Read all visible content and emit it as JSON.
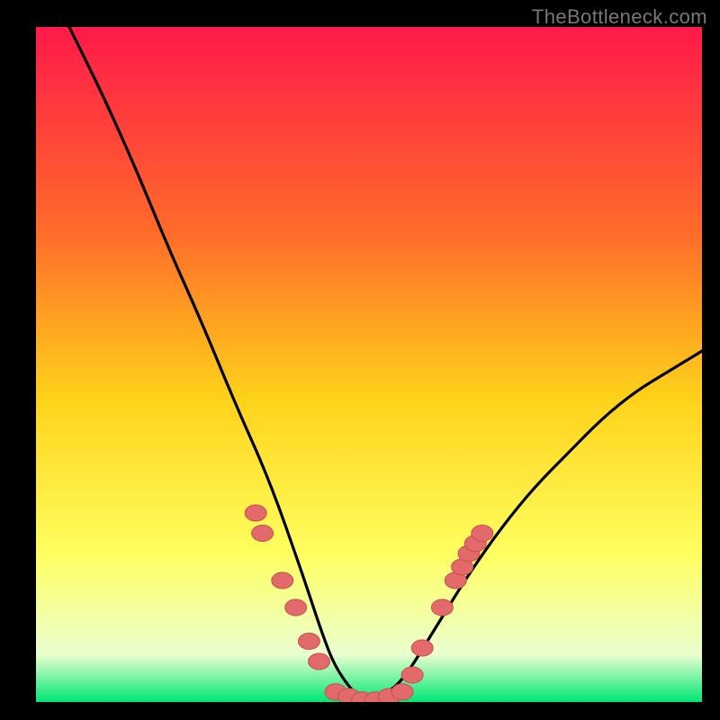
{
  "watermark": "TheBottleneck.com",
  "colors": {
    "bg_black": "#000000",
    "grad_top": "#ff1a4a",
    "grad_mid1": "#ff6a2a",
    "grad_mid2": "#ffd21a",
    "grad_mid3": "#ffff60",
    "grad_low": "#eaffd0",
    "grad_bottom": "#00e676",
    "curve": "#000000",
    "dot_fill": "#e26a6a",
    "dot_stroke": "#c94f4f"
  },
  "chart_data": {
    "type": "line",
    "title": "",
    "xlabel": "",
    "ylabel": "",
    "xlim": [
      0,
      100
    ],
    "ylim": [
      0,
      100
    ],
    "grid": false,
    "legend": false,
    "series": [
      {
        "name": "bottleneck-curve",
        "x": [
          5,
          10,
          15,
          20,
          25,
          30,
          35,
          40,
          43,
          45,
          48,
          50,
          52,
          55,
          60,
          65,
          70,
          75,
          80,
          85,
          90,
          95,
          100
        ],
        "y": [
          100,
          90,
          79,
          67,
          56,
          44,
          33,
          19,
          10,
          5,
          1,
          0,
          1,
          3,
          11,
          19,
          26,
          32,
          37,
          42,
          46,
          49,
          52
        ]
      }
    ],
    "points": [
      {
        "name": "left-branch-dot",
        "x": 33,
        "y": 28
      },
      {
        "name": "left-branch-dot",
        "x": 34,
        "y": 25
      },
      {
        "name": "left-branch-dot",
        "x": 37,
        "y": 18
      },
      {
        "name": "left-branch-dot",
        "x": 39,
        "y": 14
      },
      {
        "name": "left-branch-dot",
        "x": 41,
        "y": 9
      },
      {
        "name": "left-branch-dot",
        "x": 42.5,
        "y": 6
      },
      {
        "name": "valley-dot",
        "x": 45,
        "y": 1.5
      },
      {
        "name": "valley-dot",
        "x": 47,
        "y": 0.8
      },
      {
        "name": "valley-dot",
        "x": 49,
        "y": 0.3
      },
      {
        "name": "valley-dot",
        "x": 51,
        "y": 0.3
      },
      {
        "name": "valley-dot",
        "x": 53,
        "y": 0.8
      },
      {
        "name": "valley-dot",
        "x": 55,
        "y": 1.5
      },
      {
        "name": "right-branch-dot",
        "x": 56.5,
        "y": 4
      },
      {
        "name": "right-branch-dot",
        "x": 58,
        "y": 8
      },
      {
        "name": "right-branch-dot",
        "x": 61,
        "y": 14
      },
      {
        "name": "right-branch-dot",
        "x": 63,
        "y": 18
      },
      {
        "name": "right-branch-dot",
        "x": 64,
        "y": 20
      },
      {
        "name": "right-branch-dot",
        "x": 65,
        "y": 22
      },
      {
        "name": "right-branch-dot",
        "x": 66,
        "y": 23.5
      },
      {
        "name": "right-branch-dot",
        "x": 67,
        "y": 25
      }
    ]
  }
}
